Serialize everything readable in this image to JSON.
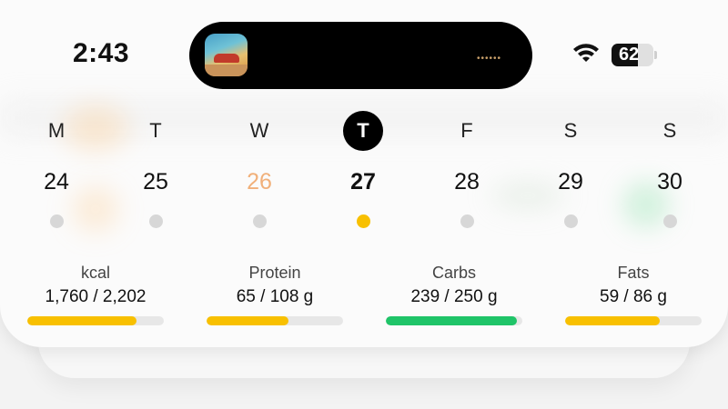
{
  "status_bar": {
    "time": "2:43",
    "battery_percent": "62",
    "battery_level": 0.62,
    "island_indicator": "••••••"
  },
  "week": {
    "days": [
      {
        "letter": "M",
        "number": "24",
        "selected": false,
        "today": false
      },
      {
        "letter": "T",
        "number": "25",
        "selected": false,
        "today": false
      },
      {
        "letter": "W",
        "number": "26",
        "selected": false,
        "today": true
      },
      {
        "letter": "T",
        "number": "27",
        "selected": true,
        "today": false
      },
      {
        "letter": "F",
        "number": "28",
        "selected": false,
        "today": false
      },
      {
        "letter": "S",
        "number": "29",
        "selected": false,
        "today": false
      },
      {
        "letter": "S",
        "number": "30",
        "selected": false,
        "today": false
      }
    ]
  },
  "macros": [
    {
      "label": "kcal",
      "value": "1,760 / 2,202",
      "progress": 0.8,
      "color": "#f8c000"
    },
    {
      "label": "Protein",
      "value": "65 / 108 g",
      "progress": 0.6,
      "color": "#f8c000"
    },
    {
      "label": "Carbs",
      "value": "239 / 250 g",
      "progress": 0.96,
      "color": "#1fc468"
    },
    {
      "label": "Fats",
      "value": "59 / 86 g",
      "progress": 0.69,
      "color": "#f8c000"
    }
  ],
  "colors": {
    "accent_yellow": "#f8c000",
    "accent_green": "#1fc468",
    "today_orange": "#f1b07a"
  }
}
